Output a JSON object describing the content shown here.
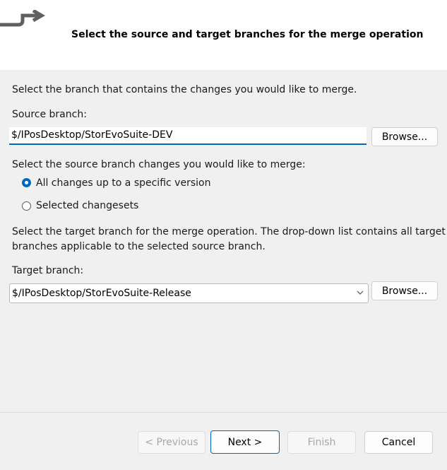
{
  "header": {
    "title": "Select the source and target branches for the merge operation",
    "icon": "merge-arrow-icon"
  },
  "source": {
    "instruction": "Select the branch that contains the changes you would like to merge.",
    "label": "Source branch:",
    "value": "$/IPosDesktop/StorEvoSuite-DEV",
    "browse_label": "Browse..."
  },
  "changes": {
    "instruction": "Select the source branch changes you would like to merge:",
    "options": [
      {
        "label": "All changes up to a specific version",
        "checked": true
      },
      {
        "label": "Selected changesets",
        "checked": false
      }
    ]
  },
  "target": {
    "instruction_line1": "Select the target branch for the merge operation.  The drop-down list contains all target",
    "instruction_line2": "branches applicable to the selected source branch.",
    "label": "Target branch:",
    "value": "$/IPosDesktop/StorEvoSuite-Release",
    "browse_label": "Browse..."
  },
  "buttons": {
    "previous": "< Previous",
    "next": "Next >",
    "finish": "Finish",
    "cancel": "Cancel"
  },
  "colors": {
    "accent": "#0067c0"
  }
}
